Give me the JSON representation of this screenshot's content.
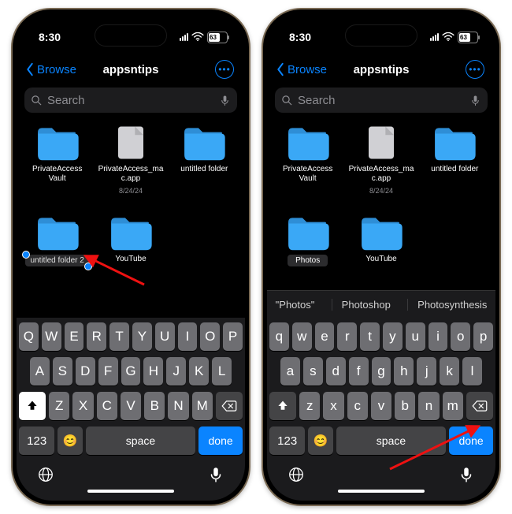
{
  "left": {
    "status": {
      "time": "8:30",
      "battery": "63"
    },
    "nav": {
      "back": "Browse",
      "title": "appsntips"
    },
    "search": {
      "placeholder": "Search"
    },
    "folders": [
      {
        "label": "PrivateAccess Vault"
      },
      {
        "label": "PrivateAccess_mac.app",
        "sub": "8/24/24"
      },
      {
        "label": "untitled folder"
      },
      {
        "label_edit": "untitled folder 2"
      },
      {
        "label": "YouTube"
      }
    ],
    "kb": {
      "r1": [
        "Q",
        "W",
        "E",
        "R",
        "T",
        "Y",
        "U",
        "I",
        "O",
        "P"
      ],
      "r2": [
        "A",
        "S",
        "D",
        "F",
        "G",
        "H",
        "J",
        "K",
        "L"
      ],
      "r3": [
        "Z",
        "X",
        "C",
        "V",
        "B",
        "N",
        "M"
      ],
      "numkey": "123",
      "space": "space",
      "done": "done"
    }
  },
  "right": {
    "status": {
      "time": "8:30",
      "battery": "63"
    },
    "nav": {
      "back": "Browse",
      "title": "appsntips"
    },
    "search": {
      "placeholder": "Search"
    },
    "folders": [
      {
        "label": "PrivateAccess Vault"
      },
      {
        "label": "PrivateAccess_mac.app",
        "sub": "8/24/24"
      },
      {
        "label": "untitled folder"
      },
      {
        "label_dark": "Photos"
      },
      {
        "label": "YouTube"
      }
    ],
    "suggest": [
      "\"Photos\"",
      "Photoshop",
      "Photosynthesis"
    ],
    "kb": {
      "r1": [
        "q",
        "w",
        "e",
        "r",
        "t",
        "y",
        "u",
        "i",
        "o",
        "p"
      ],
      "r2": [
        "a",
        "s",
        "d",
        "f",
        "g",
        "h",
        "j",
        "k",
        "l"
      ],
      "r3": [
        "z",
        "x",
        "c",
        "v",
        "b",
        "n",
        "m"
      ],
      "numkey": "123",
      "space": "space",
      "done": "done"
    }
  }
}
